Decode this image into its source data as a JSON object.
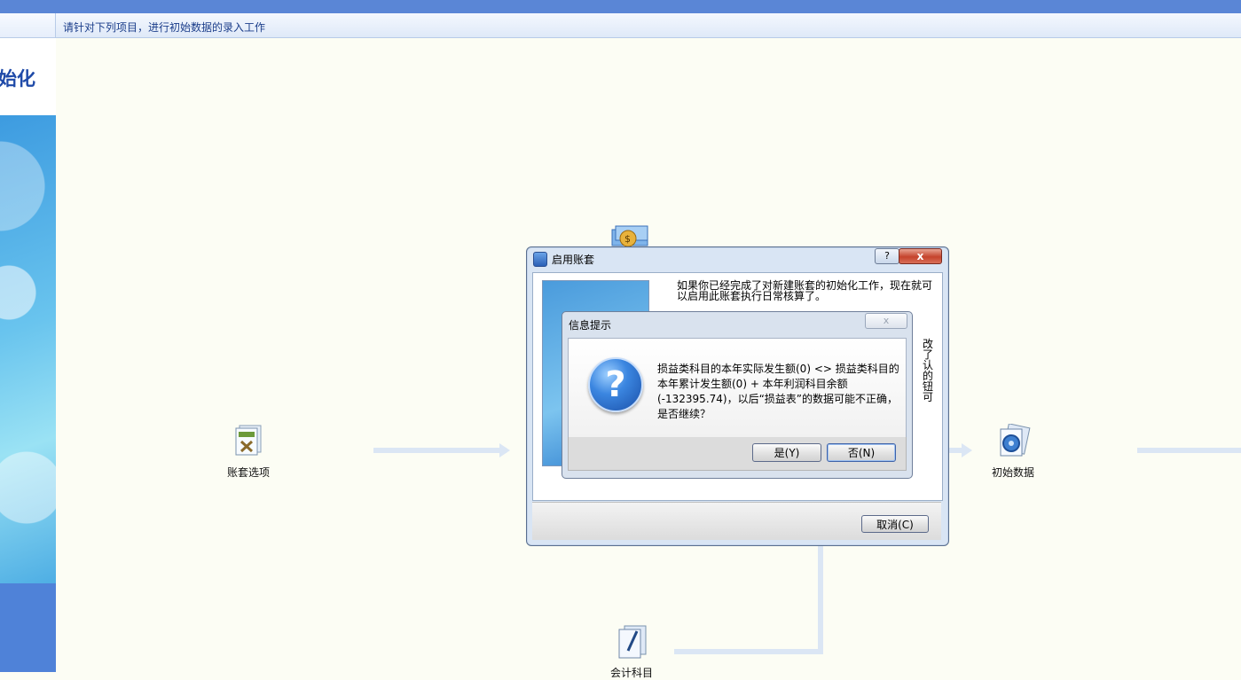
{
  "header": {
    "hint_text": "请针对下列项目，进行初始数据的录入工作"
  },
  "left_panel": {
    "title": "始化"
  },
  "workflow": {
    "node_account_options": {
      "label": "账套选项",
      "icon": "options-document-icon"
    },
    "node_initial_data": {
      "label": "初始数据",
      "icon": "gear-document-icon"
    },
    "node_accounts": {
      "label": "会计科目",
      "icon": "pen-document-icon"
    },
    "node_money": {
      "icon": "money-bag-icon"
    }
  },
  "dialog_enable_account": {
    "title": "启用账套",
    "help_label": "?",
    "close_label": "x",
    "text": "如果你已经完成了对新建账套的初始化工作，现在就可以启用此账套执行日常核算了。",
    "partial_text": "改了认的钮可",
    "cancel_label": "取消(C)"
  },
  "dialog_info": {
    "title": "信息提示",
    "close_label": "x",
    "message": "损益类科目的本年实际发生额(0) <> 损益类科目的本年累计发生额(0) + 本年利润科目余额(-132395.74)，以后“损益表”的数据可能不正确，是否继续？",
    "yes_label": "是(Y)",
    "no_label": "否(N)"
  },
  "colors": {
    "top_bar": "#5a86d6",
    "accent_blue": "#1f4aa8",
    "close_red": "#c5432c"
  }
}
